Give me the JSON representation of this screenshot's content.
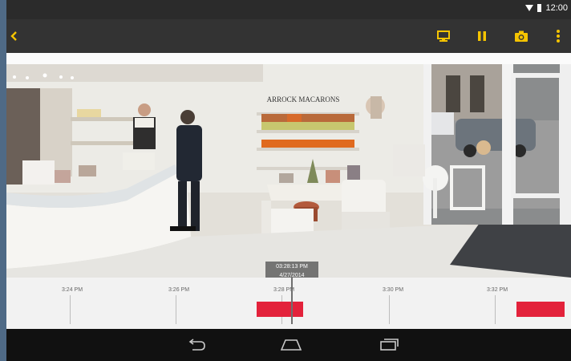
{
  "status_bar": {
    "time": "12:00"
  },
  "colors": {
    "accent_yellow": "#f5c400",
    "recording_red": "#e3223b",
    "toolbar_bg": "#333333",
    "nav_bg": "#111111"
  },
  "toolbar": {
    "back_icon": "back-arrow-icon",
    "actions": [
      "monitor-icon",
      "pause-icon",
      "camera-snapshot-icon",
      "overflow-menu-icon"
    ]
  },
  "video": {
    "shop_sign": "ARROCK MACARONS",
    "cursor_time": "03:28:13 PM",
    "cursor_date": "4/27/2014"
  },
  "timeline": {
    "ticks": [
      "3:24 PM",
      "3:26 PM",
      "3:28 PM",
      "3:30 PM",
      "3:32 PM"
    ]
  },
  "nav_bar": {
    "buttons": [
      "back-nav-icon",
      "home-nav-icon",
      "recents-nav-icon"
    ]
  }
}
